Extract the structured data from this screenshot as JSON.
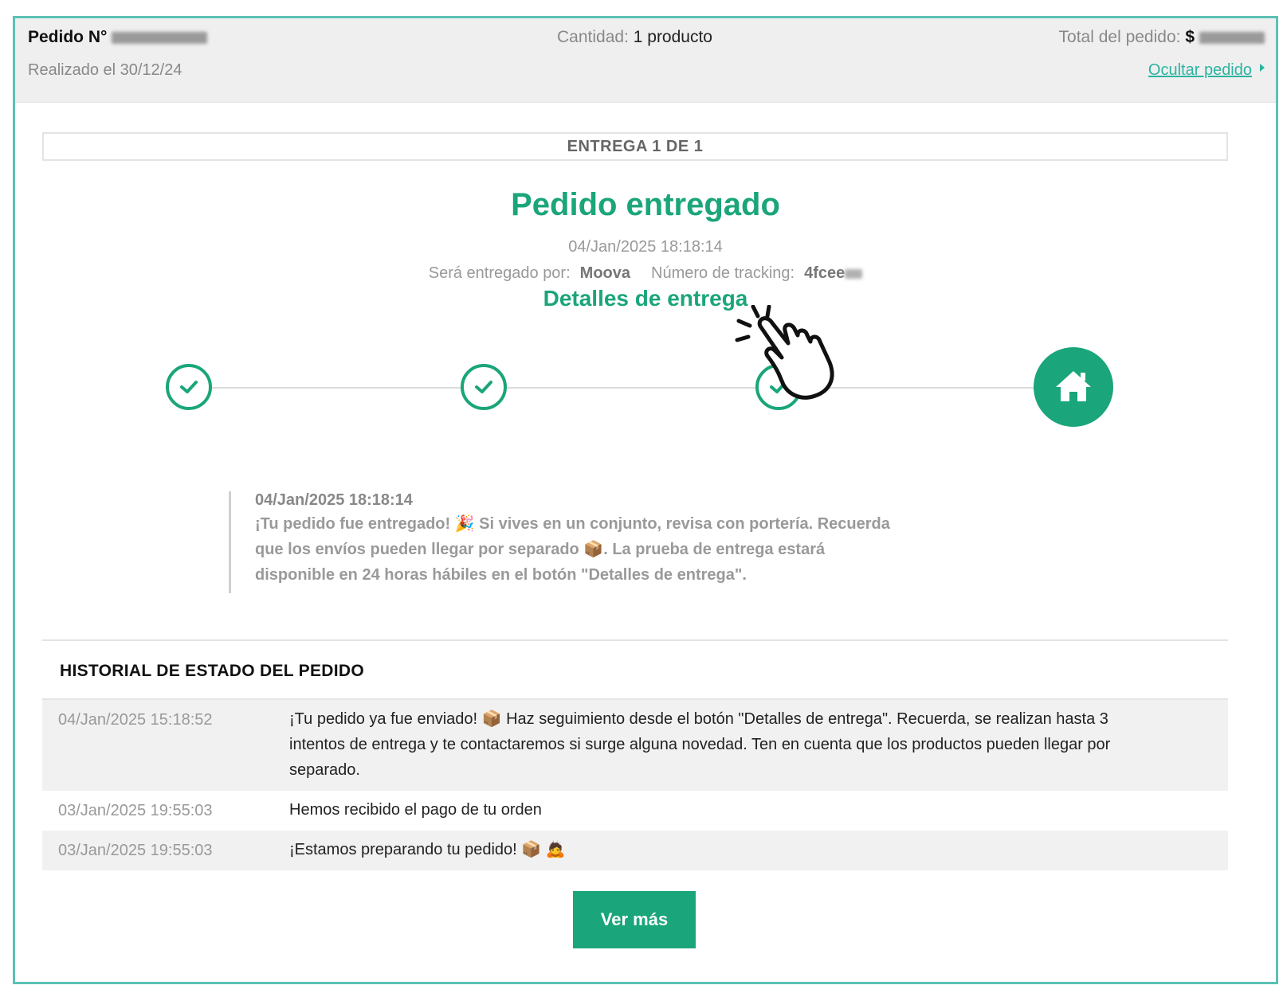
{
  "header": {
    "order_label": "Pedido N°",
    "placed_on": "Realizado el 30/12/24",
    "quantity_label": "Cantidad:",
    "quantity_value": "1 producto",
    "total_label": "Total del pedido:",
    "total_currency": "$",
    "hide_link": "Ocultar pedido"
  },
  "delivery": {
    "counter": "ENTREGA 1 DE 1",
    "status_title": "Pedido entregado",
    "status_datetime": "04/Jan/2025 18:18:14",
    "carrier_label": "Será entregado por:",
    "carrier_name": "Moova",
    "tracking_label": "Número de tracking:",
    "tracking_prefix": "4fcee",
    "details_link": "Detalles de entrega"
  },
  "latest_event": {
    "datetime": "04/Jan/2025 18:18:14",
    "line1": "¡Tu pedido fue entregado! 🎉 Si vives en un conjunto, revisa con portería. Recuerda",
    "line2": "que los envíos pueden llegar por separado 📦. La prueba de entrega estará",
    "line3": "disponible en 24 horas hábiles en el botón \"Detalles de entrega\"."
  },
  "history": {
    "title": "HISTORIAL DE ESTADO DEL PEDIDO",
    "rows": [
      {
        "date": "04/Jan/2025 15:18:52",
        "message": "¡Tu pedido ya fue enviado! 📦 Haz seguimiento desde el botón \"Detalles de entrega\". Recuerda, se realizan hasta 3 intentos de entrega y te contactaremos si surge alguna novedad. Ten en cuenta que los productos pueden llegar por separado."
      },
      {
        "date": "03/Jan/2025 19:55:03",
        "message": "Hemos recibido el pago de tu orden"
      },
      {
        "date": "03/Jan/2025 19:55:03",
        "message": "¡Estamos preparando tu pedido! 📦 🙇"
      }
    ],
    "more_button": "Ver más"
  },
  "progress": {
    "completed_steps": 3,
    "total_steps": 4
  },
  "colors": {
    "accent": "#1aa57a",
    "frame": "#5cc1b4",
    "link": "#2bb3a0"
  },
  "icons": [
    "check-icon",
    "home-icon",
    "pointer-hand-icon",
    "caret-right-icon"
  ]
}
